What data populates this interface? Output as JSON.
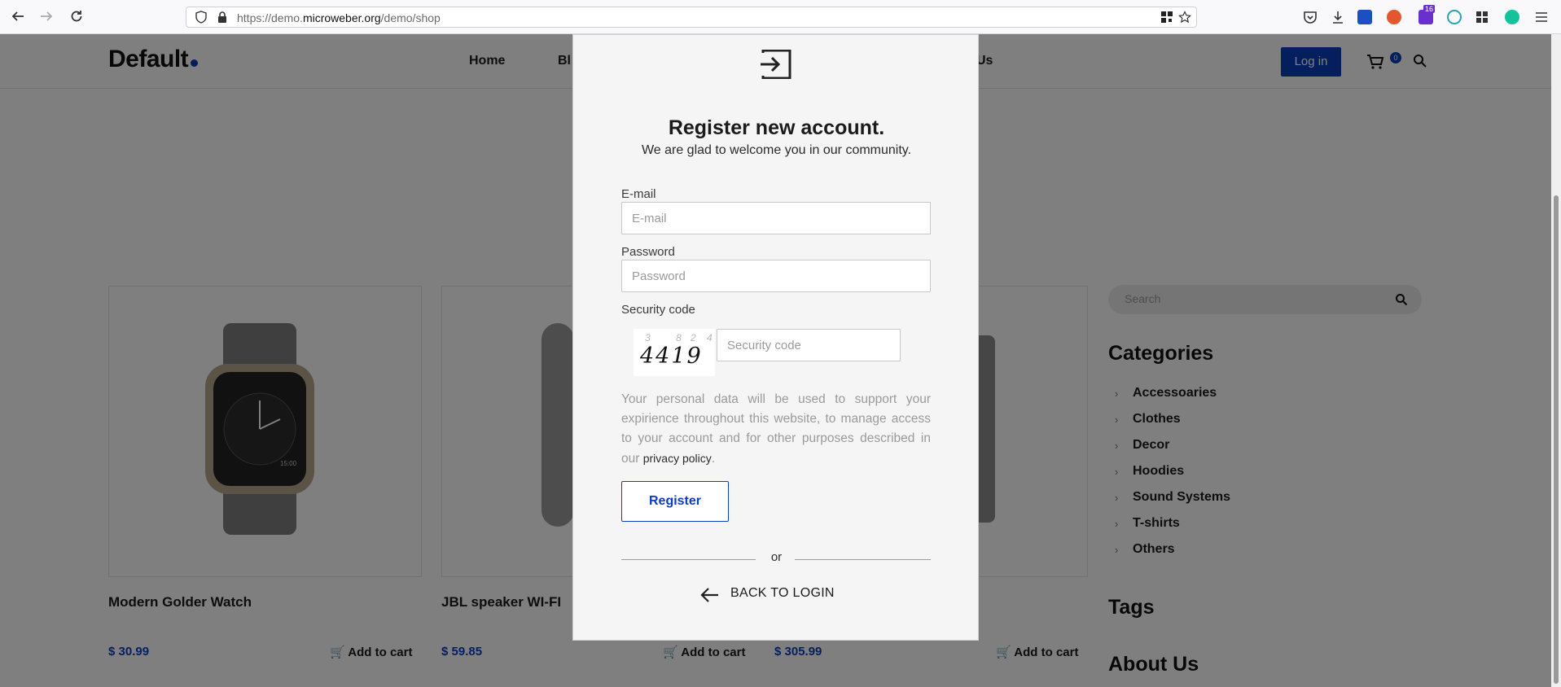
{
  "browser": {
    "url_prefix": "https://demo.",
    "url_domain": "microweber.org",
    "url_path": "/demo/shop",
    "extension_badge": "16"
  },
  "site": {
    "logo": "Default",
    "menu": [
      "Home",
      "Bl",
      "Us"
    ],
    "login_label": "Log in",
    "cart_count": "0",
    "products": [
      {
        "title": "Modern Golder Watch",
        "price": "$ 30.99",
        "cart_label": "Add to cart"
      },
      {
        "title": "JBL speaker WI-FI",
        "price": "$ 59.85",
        "cart_label": "Add to cart"
      },
      {
        "title": "",
        "price": "$ 305.99",
        "cart_label": "Add to cart"
      }
    ],
    "sidebar": {
      "search_placeholder": "Search",
      "categories_title": "Categories",
      "categories": [
        "Accessoaries",
        "Clothes",
        "Decor",
        "Hoodies",
        "Sound Systems",
        "T-shirts",
        "Others"
      ],
      "tags_title": "Tags",
      "about_title": "About Us"
    },
    "watch_time": "15:00"
  },
  "modal": {
    "title": "Register new account.",
    "subtitle": "We are glad to welcome you in our community.",
    "email_label": "E-mail",
    "email_placeholder": "E-mail",
    "password_label": "Password",
    "password_placeholder": "Password",
    "security_label": "Security code",
    "captcha_text": "4419",
    "captcha_noise": [
      "3",
      "8",
      "2",
      "4"
    ],
    "security_placeholder": "Security code",
    "privacy_text": "Your personal data will be used to support your expirience throughout this website, to manage access to your account and for other purposes described in our",
    "privacy_link": "privacy policy",
    "privacy_end": ".",
    "register_label": "Register",
    "or_text": "or",
    "back_label": "BACK TO LOGIN"
  }
}
